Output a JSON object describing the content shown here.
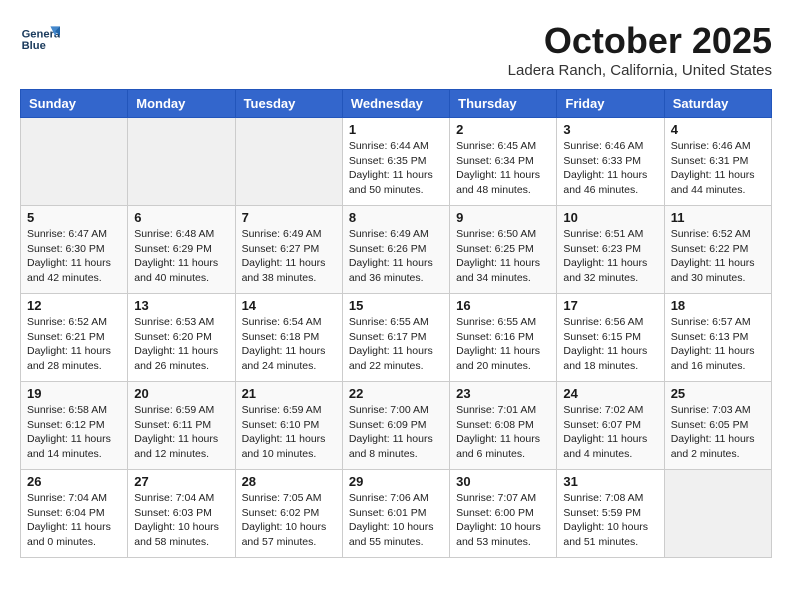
{
  "header": {
    "logo_line1": "General",
    "logo_line2": "Blue",
    "month": "October 2025",
    "location": "Ladera Ranch, California, United States"
  },
  "weekdays": [
    "Sunday",
    "Monday",
    "Tuesday",
    "Wednesday",
    "Thursday",
    "Friday",
    "Saturday"
  ],
  "weeks": [
    [
      {
        "day": "",
        "info": ""
      },
      {
        "day": "",
        "info": ""
      },
      {
        "day": "",
        "info": ""
      },
      {
        "day": "1",
        "info": "Sunrise: 6:44 AM\nSunset: 6:35 PM\nDaylight: 11 hours\nand 50 minutes."
      },
      {
        "day": "2",
        "info": "Sunrise: 6:45 AM\nSunset: 6:34 PM\nDaylight: 11 hours\nand 48 minutes."
      },
      {
        "day": "3",
        "info": "Sunrise: 6:46 AM\nSunset: 6:33 PM\nDaylight: 11 hours\nand 46 minutes."
      },
      {
        "day": "4",
        "info": "Sunrise: 6:46 AM\nSunset: 6:31 PM\nDaylight: 11 hours\nand 44 minutes."
      }
    ],
    [
      {
        "day": "5",
        "info": "Sunrise: 6:47 AM\nSunset: 6:30 PM\nDaylight: 11 hours\nand 42 minutes."
      },
      {
        "day": "6",
        "info": "Sunrise: 6:48 AM\nSunset: 6:29 PM\nDaylight: 11 hours\nand 40 minutes."
      },
      {
        "day": "7",
        "info": "Sunrise: 6:49 AM\nSunset: 6:27 PM\nDaylight: 11 hours\nand 38 minutes."
      },
      {
        "day": "8",
        "info": "Sunrise: 6:49 AM\nSunset: 6:26 PM\nDaylight: 11 hours\nand 36 minutes."
      },
      {
        "day": "9",
        "info": "Sunrise: 6:50 AM\nSunset: 6:25 PM\nDaylight: 11 hours\nand 34 minutes."
      },
      {
        "day": "10",
        "info": "Sunrise: 6:51 AM\nSunset: 6:23 PM\nDaylight: 11 hours\nand 32 minutes."
      },
      {
        "day": "11",
        "info": "Sunrise: 6:52 AM\nSunset: 6:22 PM\nDaylight: 11 hours\nand 30 minutes."
      }
    ],
    [
      {
        "day": "12",
        "info": "Sunrise: 6:52 AM\nSunset: 6:21 PM\nDaylight: 11 hours\nand 28 minutes."
      },
      {
        "day": "13",
        "info": "Sunrise: 6:53 AM\nSunset: 6:20 PM\nDaylight: 11 hours\nand 26 minutes."
      },
      {
        "day": "14",
        "info": "Sunrise: 6:54 AM\nSunset: 6:18 PM\nDaylight: 11 hours\nand 24 minutes."
      },
      {
        "day": "15",
        "info": "Sunrise: 6:55 AM\nSunset: 6:17 PM\nDaylight: 11 hours\nand 22 minutes."
      },
      {
        "day": "16",
        "info": "Sunrise: 6:55 AM\nSunset: 6:16 PM\nDaylight: 11 hours\nand 20 minutes."
      },
      {
        "day": "17",
        "info": "Sunrise: 6:56 AM\nSunset: 6:15 PM\nDaylight: 11 hours\nand 18 minutes."
      },
      {
        "day": "18",
        "info": "Sunrise: 6:57 AM\nSunset: 6:13 PM\nDaylight: 11 hours\nand 16 minutes."
      }
    ],
    [
      {
        "day": "19",
        "info": "Sunrise: 6:58 AM\nSunset: 6:12 PM\nDaylight: 11 hours\nand 14 minutes."
      },
      {
        "day": "20",
        "info": "Sunrise: 6:59 AM\nSunset: 6:11 PM\nDaylight: 11 hours\nand 12 minutes."
      },
      {
        "day": "21",
        "info": "Sunrise: 6:59 AM\nSunset: 6:10 PM\nDaylight: 11 hours\nand 10 minutes."
      },
      {
        "day": "22",
        "info": "Sunrise: 7:00 AM\nSunset: 6:09 PM\nDaylight: 11 hours\nand 8 minutes."
      },
      {
        "day": "23",
        "info": "Sunrise: 7:01 AM\nSunset: 6:08 PM\nDaylight: 11 hours\nand 6 minutes."
      },
      {
        "day": "24",
        "info": "Sunrise: 7:02 AM\nSunset: 6:07 PM\nDaylight: 11 hours\nand 4 minutes."
      },
      {
        "day": "25",
        "info": "Sunrise: 7:03 AM\nSunset: 6:05 PM\nDaylight: 11 hours\nand 2 minutes."
      }
    ],
    [
      {
        "day": "26",
        "info": "Sunrise: 7:04 AM\nSunset: 6:04 PM\nDaylight: 11 hours\nand 0 minutes."
      },
      {
        "day": "27",
        "info": "Sunrise: 7:04 AM\nSunset: 6:03 PM\nDaylight: 10 hours\nand 58 minutes."
      },
      {
        "day": "28",
        "info": "Sunrise: 7:05 AM\nSunset: 6:02 PM\nDaylight: 10 hours\nand 57 minutes."
      },
      {
        "day": "29",
        "info": "Sunrise: 7:06 AM\nSunset: 6:01 PM\nDaylight: 10 hours\nand 55 minutes."
      },
      {
        "day": "30",
        "info": "Sunrise: 7:07 AM\nSunset: 6:00 PM\nDaylight: 10 hours\nand 53 minutes."
      },
      {
        "day": "31",
        "info": "Sunrise: 7:08 AM\nSunset: 5:59 PM\nDaylight: 10 hours\nand 51 minutes."
      },
      {
        "day": "",
        "info": ""
      }
    ]
  ]
}
